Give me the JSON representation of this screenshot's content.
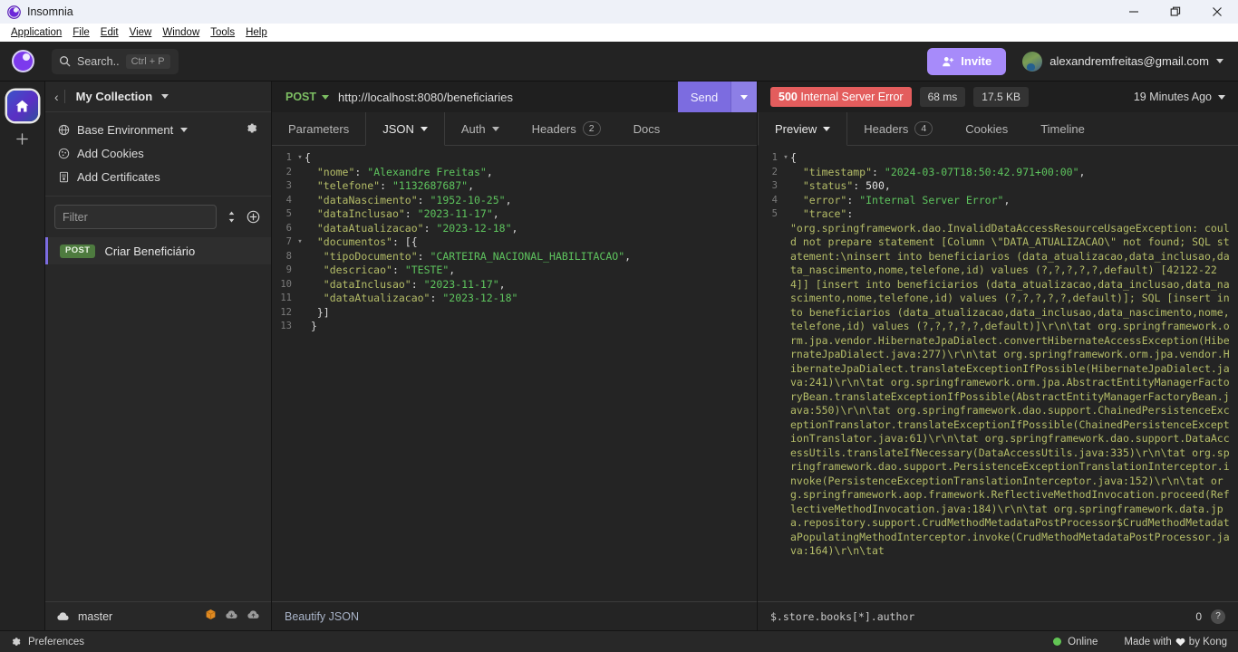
{
  "titlebar": {
    "app_title": "Insomnia",
    "minimize_label": "—",
    "maximize_label": "❐",
    "close_label": "✕"
  },
  "menubar": {
    "items": [
      "Application",
      "File",
      "Edit",
      "View",
      "Window",
      "Tools",
      "Help"
    ]
  },
  "appheader": {
    "search_placeholder": "Search..",
    "search_shortcut": "Ctrl + P",
    "invite_label": "Invite",
    "user_email": "alexandremfreitas@gmail.com"
  },
  "rail": {
    "home_label": "home-icon",
    "add_label": "+"
  },
  "sidebar": {
    "back_label": "‹",
    "collection_name": "My Collection",
    "env_row": "Base Environment",
    "cookies_row": "Add Cookies",
    "certificates_row": "Add Certificates",
    "filter_placeholder": "Filter",
    "requests": [
      {
        "method": "POST",
        "name": "Criar Beneficiário"
      }
    ],
    "footer_branch": "master"
  },
  "request": {
    "method": "POST",
    "url": "http://localhost:8080/beneficiaries",
    "send_label": "Send",
    "tabs": [
      {
        "label": "Parameters",
        "active": false,
        "caret": false,
        "badge": ""
      },
      {
        "label": "JSON",
        "active": true,
        "caret": true,
        "badge": ""
      },
      {
        "label": "Auth",
        "active": false,
        "caret": true,
        "badge": ""
      },
      {
        "label": "Headers",
        "active": false,
        "caret": false,
        "badge": "2"
      },
      {
        "label": "Docs",
        "active": false,
        "caret": false,
        "badge": ""
      }
    ],
    "beautify_label": "Beautify JSON",
    "body_lines": [
      {
        "n": 1,
        "fold": true,
        "segments": [
          {
            "t": "p",
            "v": "{"
          }
        ]
      },
      {
        "n": 2,
        "fold": false,
        "segments": [
          {
            "t": "k",
            "v": "  \"nome\""
          },
          {
            "t": "p",
            "v": ": "
          },
          {
            "t": "s",
            "v": "\"Alexandre Freitas\""
          },
          {
            "t": "p",
            "v": ","
          }
        ]
      },
      {
        "n": 3,
        "fold": false,
        "segments": [
          {
            "t": "k",
            "v": "  \"telefone\""
          },
          {
            "t": "p",
            "v": ": "
          },
          {
            "t": "s",
            "v": "\"1132687687\""
          },
          {
            "t": "p",
            "v": ","
          }
        ]
      },
      {
        "n": 4,
        "fold": false,
        "segments": [
          {
            "t": "k",
            "v": "  \"dataNascimento\""
          },
          {
            "t": "p",
            "v": ": "
          },
          {
            "t": "s",
            "v": "\"1952-10-25\""
          },
          {
            "t": "p",
            "v": ","
          }
        ]
      },
      {
        "n": 5,
        "fold": false,
        "segments": [
          {
            "t": "k",
            "v": "  \"dataInclusao\""
          },
          {
            "t": "p",
            "v": ": "
          },
          {
            "t": "s",
            "v": "\"2023-11-17\""
          },
          {
            "t": "p",
            "v": ","
          }
        ]
      },
      {
        "n": 6,
        "fold": false,
        "segments": [
          {
            "t": "k",
            "v": "  \"dataAtualizacao\""
          },
          {
            "t": "p",
            "v": ": "
          },
          {
            "t": "s",
            "v": "\"2023-12-18\""
          },
          {
            "t": "p",
            "v": ","
          }
        ]
      },
      {
        "n": 7,
        "fold": true,
        "segments": [
          {
            "t": "k",
            "v": "  \"documentos\""
          },
          {
            "t": "p",
            "v": ": [{"
          }
        ]
      },
      {
        "n": 8,
        "fold": false,
        "segments": [
          {
            "t": "k",
            "v": "   \"tipoDocumento\""
          },
          {
            "t": "p",
            "v": ": "
          },
          {
            "t": "s",
            "v": "\"CARTEIRA_NACIONAL_HABILITACAO\""
          },
          {
            "t": "p",
            "v": ","
          }
        ]
      },
      {
        "n": 9,
        "fold": false,
        "segments": [
          {
            "t": "k",
            "v": "   \"descricao\""
          },
          {
            "t": "p",
            "v": ": "
          },
          {
            "t": "s",
            "v": "\"TESTE\""
          },
          {
            "t": "p",
            "v": ","
          }
        ]
      },
      {
        "n": 10,
        "fold": false,
        "segments": [
          {
            "t": "k",
            "v": "   \"dataInclusao\""
          },
          {
            "t": "p",
            "v": ": "
          },
          {
            "t": "s",
            "v": "\"2023-11-17\""
          },
          {
            "t": "p",
            "v": ","
          }
        ]
      },
      {
        "n": 11,
        "fold": false,
        "segments": [
          {
            "t": "k",
            "v": "   \"dataAtualizacao\""
          },
          {
            "t": "p",
            "v": ": "
          },
          {
            "t": "s",
            "v": "\"2023-12-18\""
          }
        ]
      },
      {
        "n": 12,
        "fold": false,
        "segments": [
          {
            "t": "p",
            "v": "  }]"
          }
        ]
      },
      {
        "n": 13,
        "fold": false,
        "segments": [
          {
            "t": "p",
            "v": " }"
          }
        ]
      }
    ]
  },
  "response": {
    "status_code": "500",
    "status_text": "Internal Server Error",
    "time": "68 ms",
    "size": "17.5 KB",
    "time_ago": "19 Minutes Ago",
    "tabs": [
      {
        "label": "Preview",
        "active": true,
        "caret": true,
        "badge": ""
      },
      {
        "label": "Headers",
        "active": false,
        "caret": false,
        "badge": "4"
      },
      {
        "label": "Cookies",
        "active": false,
        "caret": false,
        "badge": ""
      },
      {
        "label": "Timeline",
        "active": false,
        "caret": false,
        "badge": ""
      }
    ],
    "jsonpath_query": "$.store.books[*].author",
    "jsonpath_count": "0",
    "help_label": "?",
    "body_lines": [
      {
        "n": 1,
        "fold": true,
        "segments": [
          {
            "t": "p",
            "v": "{"
          }
        ]
      },
      {
        "n": 2,
        "fold": false,
        "segments": [
          {
            "t": "k",
            "v": "  \"timestamp\""
          },
          {
            "t": "p",
            "v": ": "
          },
          {
            "t": "s",
            "v": "\"2024-03-07T18:50:42.971+00:00\""
          },
          {
            "t": "p",
            "v": ","
          }
        ]
      },
      {
        "n": 3,
        "fold": false,
        "segments": [
          {
            "t": "k",
            "v": "  \"status\""
          },
          {
            "t": "p",
            "v": ": "
          },
          {
            "t": "n",
            "v": "500"
          },
          {
            "t": "p",
            "v": ","
          }
        ]
      },
      {
        "n": 4,
        "fold": false,
        "segments": [
          {
            "t": "k",
            "v": "  \"error\""
          },
          {
            "t": "p",
            "v": ": "
          },
          {
            "t": "s",
            "v": "\"Internal Server Error\""
          },
          {
            "t": "p",
            "v": ","
          }
        ]
      },
      {
        "n": 5,
        "fold": false,
        "segments": [
          {
            "t": "k",
            "v": "  \"trace\""
          },
          {
            "t": "p",
            "v": ":"
          }
        ]
      }
    ],
    "trace_text": "\"org.springframework.dao.InvalidDataAccessResourceUsageException: could not prepare statement [Column \\\"DATA_ATUALIZACAO\\\" not found; SQL statement:\\ninsert into beneficiarios (data_atualizacao,data_inclusao,data_nascimento,nome,telefone,id) values (?,?,?,?,?,default) [42122-224]] [insert into beneficiarios (data_atualizacao,data_inclusao,data_nascimento,nome,telefone,id) values (?,?,?,?,?,default)]; SQL [insert into beneficiarios (data_atualizacao,data_inclusao,data_nascimento,nome,telefone,id) values (?,?,?,?,?,default)]\\r\\n\\tat org.springframework.orm.jpa.vendor.HibernateJpaDialect.convertHibernateAccessException(HibernateJpaDialect.java:277)\\r\\n\\tat org.springframework.orm.jpa.vendor.HibernateJpaDialect.translateExceptionIfPossible(HibernateJpaDialect.java:241)\\r\\n\\tat org.springframework.orm.jpa.AbstractEntityManagerFactoryBean.translateExceptionIfPossible(AbstractEntityManagerFactoryBean.java:550)\\r\\n\\tat org.springframework.dao.support.ChainedPersistenceExceptionTranslator.translateExceptionIfPossible(ChainedPersistenceExceptionTranslator.java:61)\\r\\n\\tat org.springframework.dao.support.DataAccessUtils.translateIfNecessary(DataAccessUtils.java:335)\\r\\n\\tat org.springframework.dao.support.PersistenceExceptionTranslationInterceptor.invoke(PersistenceExceptionTranslationInterceptor.java:152)\\r\\n\\tat org.springframework.aop.framework.ReflectiveMethodInvocation.proceed(ReflectiveMethodInvocation.java:184)\\r\\n\\tat org.springframework.data.jpa.repository.support.CrudMethodMetadataPostProcessor$CrudMethodMetadataPopulatingMethodInterceptor.invoke(CrudMethodMetadataPostProcessor.java:164)\\r\\n\\tat "
  },
  "statusbar": {
    "preferences_label": "Preferences",
    "online_label": "Online",
    "made_with_prefix": "Made with",
    "made_with_suffix": "by Kong"
  },
  "colors": {
    "accent_purple": "#7c6ce0",
    "error_red": "#e35d5d",
    "method_green": "#4e7b3f",
    "online_green": "#62c554"
  }
}
